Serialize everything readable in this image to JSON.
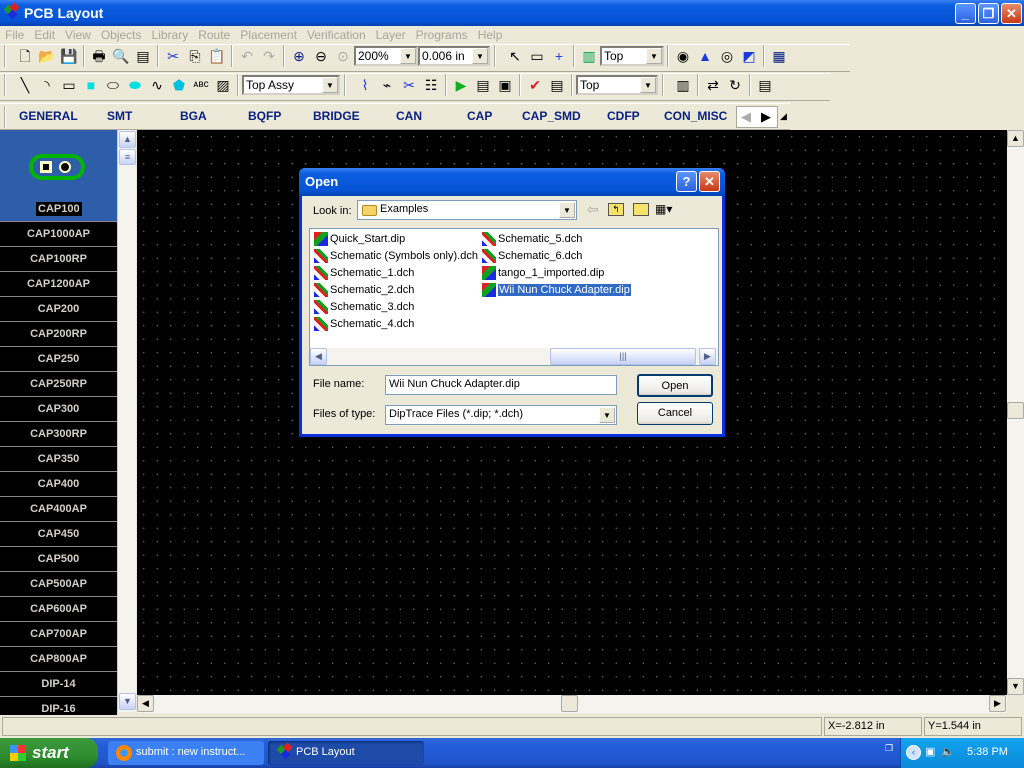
{
  "window": {
    "title": "PCB Layout",
    "controls": [
      "_",
      "❐",
      "✕"
    ]
  },
  "menu": [
    "File",
    "Edit",
    "View",
    "Objects",
    "Library",
    "Route",
    "Placement",
    "Verification",
    "Layer",
    "Programs",
    "Help"
  ],
  "toolbar1": {
    "icons_a": [
      "new-file-icon",
      "open-folder-icon",
      "save-icon",
      "print-icon",
      "print-preview-icon",
      "report-icon",
      "cut-icon",
      "copy-icon",
      "paste-icon",
      "undo-icon",
      "redo-icon",
      "zoom-in-icon",
      "zoom-out-icon",
      "zoom-fit-icon"
    ],
    "zoom": "200%",
    "grid": "0.006 in",
    "icons_b": [
      "pointer-icon",
      "ruler-icon",
      "crosshair-icon",
      "component-icon"
    ],
    "layer": "Top",
    "icons_c": [
      "pad-icon",
      "via-route-icon",
      "hole-icon",
      "copper-pour-icon",
      "grid-icon"
    ]
  },
  "toolbar2": {
    "icons_a": [
      "line-icon",
      "arc-icon",
      "rectangle-icon",
      "filled-rectangle-icon",
      "ellipse-icon",
      "filled-ellipse-icon",
      "polyline-icon",
      "polygon-icon",
      "text-icon",
      "image-icon"
    ],
    "assy": "Top Assy",
    "icons_b": [
      "route-trace-icon",
      "route-edit-icon",
      "unroute-icon",
      "net-list-icon",
      "autoroute-run-icon",
      "autoroute-step-icon",
      "autoroute-check-icon",
      "drc-icon",
      "drc-report-icon"
    ],
    "layer": "Top",
    "icons_c": [
      "align-components-icon",
      "swap-components-icon",
      "rotate-components-icon",
      "component-props-icon"
    ]
  },
  "library_tabs": [
    "GENERAL",
    "SMT",
    "BGA",
    "BQFP",
    "BRIDGE",
    "CAN",
    "CAP",
    "CAP_SMD",
    "CDFP",
    "CON_MISC"
  ],
  "components": {
    "selected": "CAP100",
    "items": [
      "CAP1000AP",
      "CAP100RP",
      "CAP1200AP",
      "CAP200",
      "CAP200RP",
      "CAP250",
      "CAP250RP",
      "CAP300",
      "CAP300RP",
      "CAP350",
      "CAP400",
      "CAP400AP",
      "CAP450",
      "CAP500",
      "CAP500AP",
      "CAP600AP",
      "CAP700AP",
      "CAP800AP",
      "DIP-14",
      "DIP-16"
    ]
  },
  "status": {
    "x": "X=-2.812 in",
    "y": "Y=1.544 in"
  },
  "taskbar": {
    "start": "start",
    "tasks": [
      "submit : new instruct...",
      "PCB Layout"
    ],
    "clock": "5:38 PM"
  },
  "dialog": {
    "title": "Open",
    "look_in_label": "Look in:",
    "look_in": "Examples",
    "files": [
      {
        "name": "Quick_Start.dip",
        "type": "dip"
      },
      {
        "name": "Schematic (Symbols only).dch",
        "type": "dch"
      },
      {
        "name": "Schematic_1.dch",
        "type": "dch"
      },
      {
        "name": "Schematic_2.dch",
        "type": "dch"
      },
      {
        "name": "Schematic_3.dch",
        "type": "dch"
      },
      {
        "name": "Schematic_4.dch",
        "type": "dch"
      },
      {
        "name": "Schematic_5.dch",
        "type": "dch"
      },
      {
        "name": "Schematic_6.dch",
        "type": "dch"
      },
      {
        "name": "tango_1_imported.dip",
        "type": "dip"
      },
      {
        "name": "Wii Nun Chuck Adapter.dip",
        "type": "dip",
        "selected": true
      }
    ],
    "file_name_label": "File name:",
    "file_name": "Wii Nun Chuck Adapter.dip",
    "files_of_type_label": "Files of type:",
    "files_of_type": "DipTrace Files (*.dip; *.dch)",
    "open": "Open",
    "cancel": "Cancel"
  },
  "colors": {
    "accent": "#0a2180",
    "selection": "#316ac5",
    "canvas": "#000000"
  }
}
